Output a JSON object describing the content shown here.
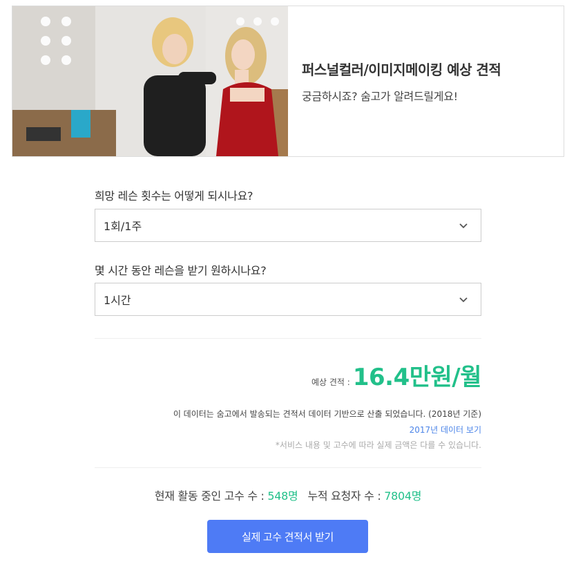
{
  "hero": {
    "title": "퍼스널컬러/이미지메이킹 예상 견적",
    "subtitle": "궁금하시죠? 숨고가 알려드릴게요!"
  },
  "questions": [
    {
      "label": "희망 레슨 횟수는 어떻게 되시나요?",
      "selected": "1회/1주"
    },
    {
      "label": "몇 시간 동안 레슨을 받기 원하시나요?",
      "selected": "1시간"
    }
  ],
  "estimate": {
    "label": "예상 견적 :",
    "value": "16.4만원/월"
  },
  "notes": {
    "main": "이 데이터는 숨고에서 발송되는 견적서 데이터 기반으로 산출 되었습니다. (2018년 기준)",
    "link": "2017년 데이터 보기",
    "disclaimer": "*서비스 내용 및 고수에 따라 실제 금액은 다를 수 있습니다."
  },
  "stats": {
    "active_label": "현재 활동 중인 고수 수 : ",
    "active_value": "548명",
    "requests_label": "누적 요청자 수 : ",
    "requests_value": "7804명"
  },
  "cta": {
    "label": "실제 고수 견적서 받기"
  },
  "colors": {
    "accent_green": "#22c08a",
    "button_blue": "#4e7bf5",
    "link_blue": "#4b84e8"
  },
  "icons": {
    "select_chevron": "chevron-down-icon"
  }
}
